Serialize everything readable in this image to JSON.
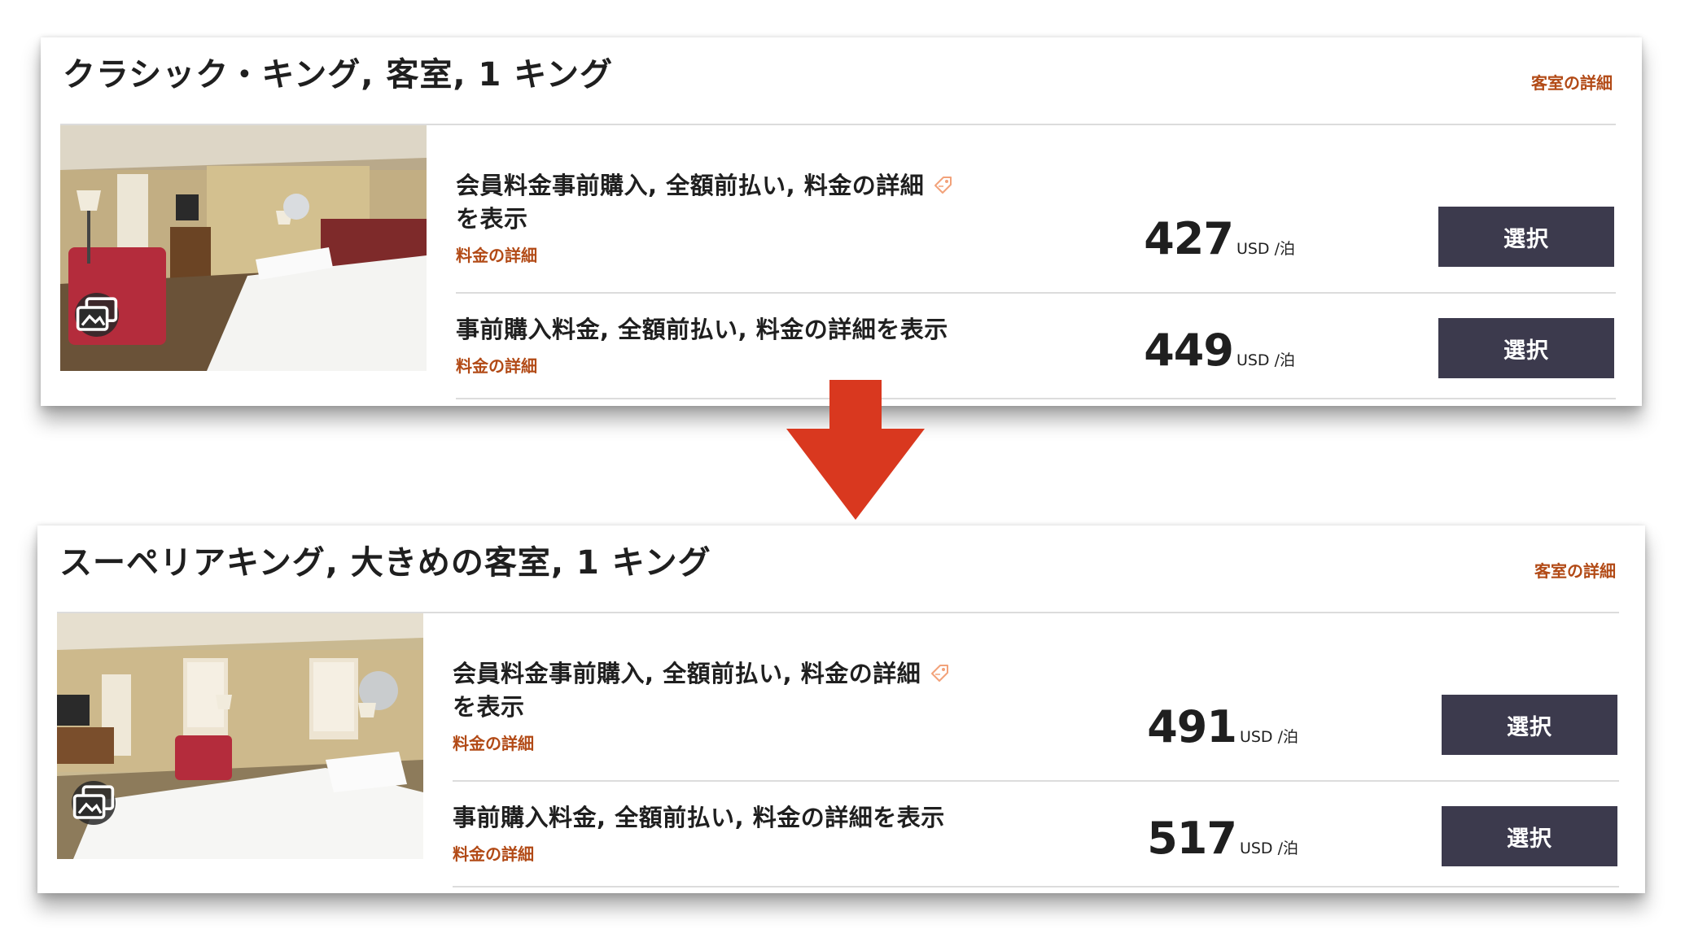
{
  "rooms": [
    {
      "title": "クラシック・キング, 客室, 1 キング",
      "details_link": "客室の詳細",
      "rates": [
        {
          "name_line1": "会員料金事前購入, 全額前払い, 料金の詳細",
          "name_line2": "を表示",
          "details_link": "料金の詳細",
          "price": "427",
          "unit": "USD /泊",
          "select_label": "選択",
          "icon": "price-tag-icon"
        },
        {
          "name": "事前購入料金, 全額前払い, 料金の詳細を表示",
          "details_link": "料金の詳細",
          "price": "449",
          "unit": "USD /泊",
          "select_label": "選択"
        }
      ]
    },
    {
      "title": "スーペリアキング, 大きめの客室, 1 キング",
      "details_link": "客室の詳細",
      "rates": [
        {
          "name_line1": "会員料金事前購入, 全額前払い, 料金の詳細",
          "name_line2": "を表示",
          "details_link": "料金の詳細",
          "price": "491",
          "unit": "USD /泊",
          "select_label": "選択",
          "icon": "price-tag-icon"
        },
        {
          "name": "事前購入料金, 全額前払い, 料金の詳細を表示",
          "details_link": "料金の詳細",
          "price": "517",
          "unit": "USD /泊",
          "select_label": "選択"
        }
      ]
    }
  ],
  "colors": {
    "accent": "#b24a16",
    "button": "#3c3a4d",
    "arrow": "#d9381f",
    "divider": "#dcdcdc"
  },
  "icons": [
    "gallery-icon",
    "price-tag-icon",
    "down-arrow"
  ]
}
